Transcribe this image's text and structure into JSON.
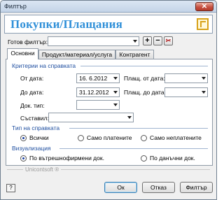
{
  "window": {
    "title": "Филтър",
    "close_glyph": "✕"
  },
  "header": {
    "title": "Покупки/Плащания",
    "icon": "document-frame-icon"
  },
  "ready_filter": {
    "label": "Готов филтър:",
    "value": "",
    "add_glyph": "+",
    "remove_glyph": "−",
    "clear_glyph": "✂"
  },
  "tabs": [
    {
      "label": "Основни",
      "active": true
    },
    {
      "label": "Продукт/материал/услуга",
      "active": false
    },
    {
      "label": "Контрагент",
      "active": false
    }
  ],
  "criteria": {
    "section_title": "Критерии на справката",
    "from_date_label": "От дата:",
    "from_date_value": "16.  6.2012",
    "to_date_label": "До дата:",
    "to_date_value": "31.12.2012",
    "pay_from_label": "Плащ. от дата:",
    "pay_from_value": "",
    "pay_to_label": "Плащ. до дата:",
    "pay_to_value": "",
    "doc_type_label": "Док. тип:",
    "doc_type_value": "",
    "author_label": "Съставил:",
    "author_value": ""
  },
  "report_type": {
    "section_title": "Тип на справката",
    "options": [
      "Всички",
      "Само платените",
      "Само неплатените"
    ],
    "selected": 0
  },
  "visualization": {
    "section_title": "Визуализация",
    "options": [
      "По вътрешнофирмени док.",
      "По данъчни док."
    ],
    "selected": 0
  },
  "footer": {
    "brand": "Unicontsoft ®",
    "help_glyph": "?",
    "ok_label": "Ок",
    "cancel_label": "Отказ",
    "filter_label": "Филтър"
  }
}
